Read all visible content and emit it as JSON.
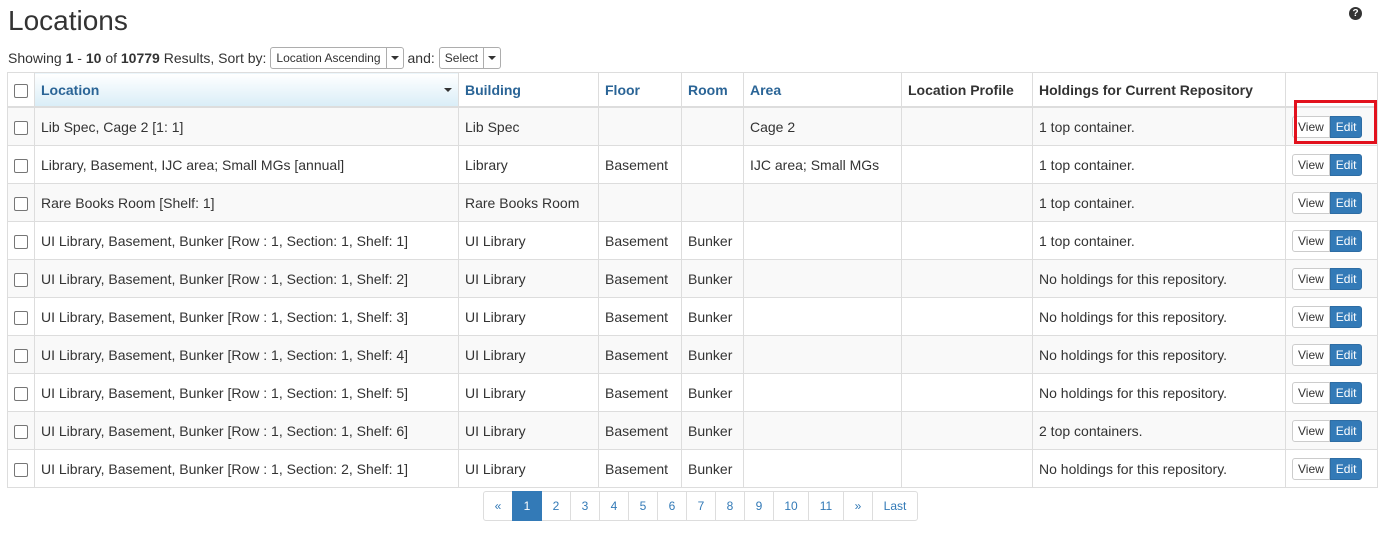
{
  "page": {
    "title": "Locations",
    "help_icon": "question-circle-icon"
  },
  "results": {
    "showing_label": "Showing",
    "range_start": "1",
    "range_sep": "-",
    "range_end": "10",
    "of_label": "of",
    "total": "10779",
    "results_label": "Results, Sort by:",
    "sort_value": "Location Ascending",
    "and_label": "and:",
    "secondary_sort_value": "Select"
  },
  "table": {
    "headers": [
      "Location",
      "Building",
      "Floor",
      "Room",
      "Area",
      "Location Profile",
      "Holdings for Current Repository",
      ""
    ],
    "rows": [
      {
        "location": "Lib Spec, Cage 2 [1: 1]",
        "building": "Lib Spec",
        "floor": "",
        "room": "",
        "area": "Cage 2",
        "profile": "",
        "holdings": "1 top container."
      },
      {
        "location": "Library, Basement, IJC area; Small MGs [annual]",
        "building": "Library",
        "floor": "Basement",
        "room": "",
        "area": "IJC area; Small MGs",
        "profile": "",
        "holdings": "1 top container."
      },
      {
        "location": "Rare Books Room [Shelf: 1]",
        "building": "Rare Books Room",
        "floor": "",
        "room": "",
        "area": "",
        "profile": "",
        "holdings": "1 top container."
      },
      {
        "location": "UI Library, Basement, Bunker [Row : 1, Section: 1, Shelf: 1]",
        "building": "UI Library",
        "floor": "Basement",
        "room": "Bunker",
        "area": "",
        "profile": "",
        "holdings": "1 top container."
      },
      {
        "location": "UI Library, Basement, Bunker [Row : 1, Section: 1, Shelf: 2]",
        "building": "UI Library",
        "floor": "Basement",
        "room": "Bunker",
        "area": "",
        "profile": "",
        "holdings": "No holdings for this repository."
      },
      {
        "location": "UI Library, Basement, Bunker [Row : 1, Section: 1, Shelf: 3]",
        "building": "UI Library",
        "floor": "Basement",
        "room": "Bunker",
        "area": "",
        "profile": "",
        "holdings": "No holdings for this repository."
      },
      {
        "location": "UI Library, Basement, Bunker [Row : 1, Section: 1, Shelf: 4]",
        "building": "UI Library",
        "floor": "Basement",
        "room": "Bunker",
        "area": "",
        "profile": "",
        "holdings": "No holdings for this repository."
      },
      {
        "location": "UI Library, Basement, Bunker [Row : 1, Section: 1, Shelf: 5]",
        "building": "UI Library",
        "floor": "Basement",
        "room": "Bunker",
        "area": "",
        "profile": "",
        "holdings": "No holdings for this repository."
      },
      {
        "location": "UI Library, Basement, Bunker [Row : 1, Section: 1, Shelf: 6]",
        "building": "UI Library",
        "floor": "Basement",
        "room": "Bunker",
        "area": "",
        "profile": "",
        "holdings": "2 top containers."
      },
      {
        "location": "UI Library, Basement, Bunker [Row : 1, Section: 2, Shelf: 1]",
        "building": "UI Library",
        "floor": "Basement",
        "room": "Bunker",
        "area": "",
        "profile": "",
        "holdings": "No holdings for this repository."
      }
    ],
    "view_label": "View",
    "edit_label": "Edit"
  },
  "pagination": {
    "items": [
      "«",
      "1",
      "2",
      "3",
      "4",
      "5",
      "6",
      "7",
      "8",
      "9",
      "10",
      "11",
      "»",
      "Last"
    ],
    "active": "1"
  }
}
